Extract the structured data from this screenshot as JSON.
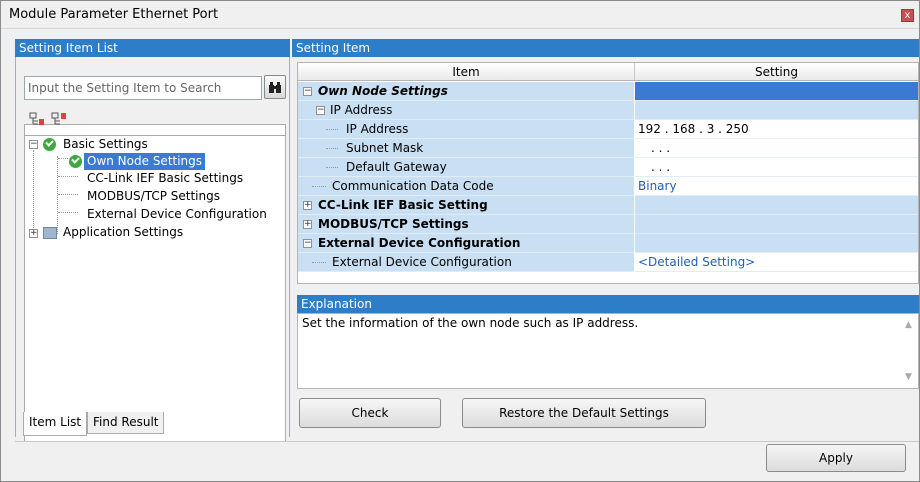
{
  "window": {
    "title": "Module Parameter Ethernet Port",
    "close_label": "x"
  },
  "left_panel": {
    "header": "Setting Item List",
    "search_placeholder": "Input the Setting Item to Search",
    "tree": {
      "basic": "Basic Settings",
      "own_node": "Own Node Settings",
      "cclink": "CC-Link IEF Basic Settings",
      "modbus": "MODBUS/TCP Settings",
      "external": "External Device Configuration",
      "application": "Application Settings"
    },
    "tabs": {
      "item_list": "Item List",
      "find_result": "Find Result"
    }
  },
  "right_panel": {
    "header": "Setting Item",
    "columns": {
      "item": "Item",
      "setting": "Setting"
    },
    "rows": {
      "r0": {
        "item": "Own Node Settings",
        "setting": ""
      },
      "r1": {
        "item": "IP Address",
        "setting": ""
      },
      "r2": {
        "item": "IP Address",
        "setting": "192 . 168 .   3 . 250"
      },
      "r3": {
        "item": "Subnet Mask",
        "setting": ".     .     ."
      },
      "r4": {
        "item": "Default Gateway",
        "setting": ".     .     ."
      },
      "r5": {
        "item": "Communication Data Code",
        "setting": "Binary"
      },
      "r6": {
        "item": "CC-Link IEF Basic Setting",
        "setting": ""
      },
      "r7": {
        "item": "MODBUS/TCP Settings",
        "setting": ""
      },
      "r8": {
        "item": "External Device Configuration",
        "setting": ""
      },
      "r9": {
        "item": "External Device Configuration",
        "setting": "<Detailed Setting>"
      }
    },
    "explanation": {
      "header": "Explanation",
      "text": "Set the information of the own node such as IP address."
    },
    "buttons": {
      "check": "Check",
      "restore": "Restore the Default Settings"
    }
  },
  "footer": {
    "apply": "Apply"
  },
  "colors": {
    "header_blue": "#2d7dc8",
    "item_cell": "#c9dff3",
    "selected": "#3a7ad2"
  }
}
